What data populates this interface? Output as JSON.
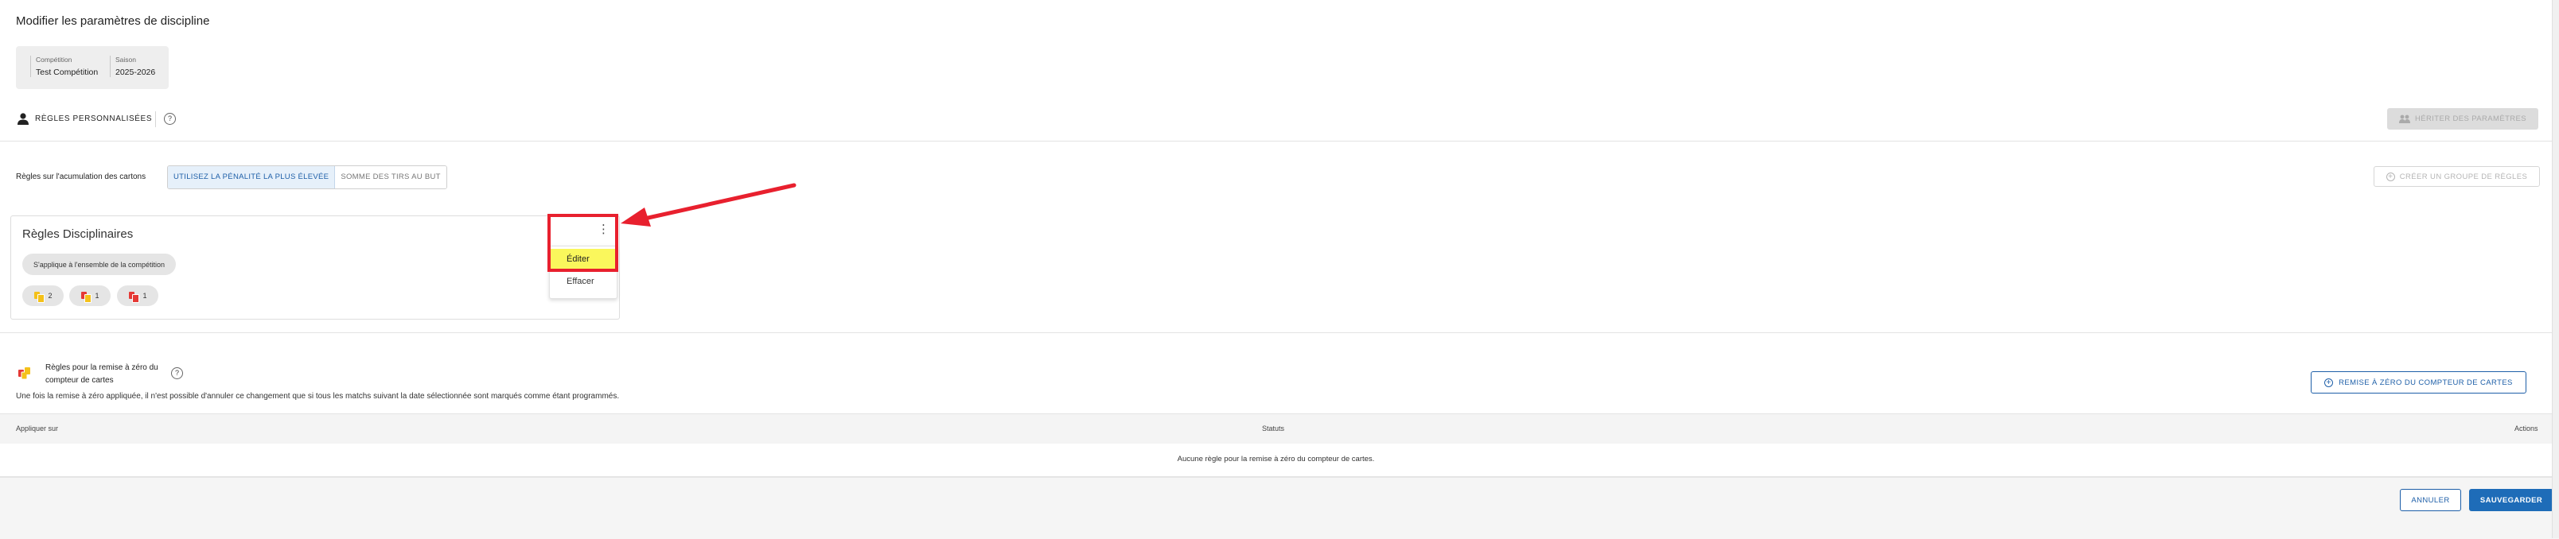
{
  "page": {
    "title": "Modifier les paramètres de discipline"
  },
  "context": {
    "competition_label": "Compétition",
    "competition_value": "Test Compétition",
    "season_label": "Saison",
    "season_value": "2025-2026"
  },
  "rules_section": {
    "title": "RÈGLES PERSONNALISÉES",
    "help_glyph": "?",
    "inherit_button": "HÉRITER DES PARAMÈTRES"
  },
  "accumulation": {
    "label": "Règles sur l'acumulation des cartons",
    "options": [
      "UTILISEZ LA PÉNALITÉ LA PLUS ÉLEVÉE",
      "SOMME DES TIRS AU BUT"
    ],
    "selected": "UTILISEZ LA PÉNALITÉ LA PLUS ÉLEVÉE",
    "create_group_button": "CRÉER UN GROUPE DE RÈGLES"
  },
  "rule_card": {
    "title": "Règles Disciplinaires",
    "scope_chip": "S'applique à l'ensemble de la compétition",
    "chips": [
      {
        "icon": "yellow-yellow-card-icon",
        "count": "2"
      },
      {
        "icon": "yellow-red-card-icon",
        "count": "1"
      },
      {
        "icon": "red-card-icon",
        "count": "1"
      }
    ],
    "menu": {
      "kebab_glyph": "⋮",
      "items": [
        "Éditer",
        "Effacer"
      ]
    }
  },
  "reset_section": {
    "title": "Règles pour la remise à zéro du compteur de cartes",
    "help_glyph": "?",
    "info": "Une fois la remise à zéro appliquée, il n'est possible d'annuler ce changement que si tous les matchs suivant la date sélectionnée sont marqués comme étant programmés.",
    "button": "REMISE À ZÉRO DU COMPTEUR DE CARTES",
    "table": {
      "headers": [
        "Appliquer sur",
        "Statuts",
        "Actions"
      ],
      "empty": "Aucune règle pour la remise à zéro du compteur de cartes."
    }
  },
  "footer": {
    "cancel": "ANNULER",
    "save": "SAUVEGARDER"
  },
  "colors": {
    "primary": "#1e6cb8",
    "highlight_border": "#e8202e",
    "highlight_fill": "#faf75c",
    "yellow_card": "#f4c11a",
    "red_card": "#e53935"
  }
}
